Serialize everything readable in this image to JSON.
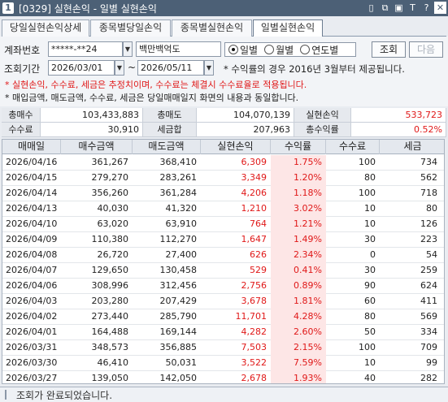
{
  "window": {
    "number": "1",
    "title": "[0329] 실현손익 - 일별 실현손익",
    "icons": [
      "restore-icon",
      "new-window-icon",
      "copy-icon",
      "pin-icon",
      "help-icon",
      "close-icon"
    ],
    "icon_glyphs": [
      "▯",
      "⧉",
      "▣",
      "T",
      "?",
      "✕"
    ]
  },
  "tabs": [
    {
      "label": "당일실현손익상세",
      "active": false
    },
    {
      "label": "종목별당일손익",
      "active": false
    },
    {
      "label": "종목별실현손익",
      "active": false
    },
    {
      "label": "일별실현손익",
      "active": true
    }
  ],
  "form": {
    "account_label": "계좌번호",
    "account_value": "*****-**24",
    "account_name": "백만백억도",
    "radio": [
      {
        "label": "일별",
        "checked": true
      },
      {
        "label": "월별",
        "checked": false
      },
      {
        "label": "연도별",
        "checked": false
      }
    ],
    "query_button": "조회",
    "next_button": "다음",
    "period_label": "조회기간",
    "start_date": "2026/03/01",
    "tilde": "~",
    "end_date": "2026/05/11",
    "period_note": "* 수익률의 경우 2016년 3월부터 제공됩니다.",
    "note1": "* 실현손익, 수수료, 세금은 추정치이며, 수수료는 체결시 수수료율로 적용됩니다.",
    "note2": "* 매입금액, 매도금액, 수수료, 세금은 당일매매일지 화면의 내용과 동일합니다."
  },
  "summary": {
    "total_buy_label": "총매수",
    "total_buy": "103,433,883",
    "total_sell_label": "총매도",
    "total_sell": "104,070,139",
    "realized_label": "실현손익",
    "realized": "533,723",
    "fee_label": "수수료",
    "fee": "30,910",
    "tax_label": "세금합",
    "tax": "207,963",
    "return_label": "총수익률",
    "return": "0.52%"
  },
  "table": {
    "columns": [
      "매매일",
      "매수금액",
      "매도금액",
      "실현손익",
      "수익률",
      "수수료",
      "세금"
    ],
    "rows": [
      [
        "2026/04/16",
        "361,267",
        "368,410",
        "6,309",
        "1.75%",
        "100",
        "734"
      ],
      [
        "2026/04/15",
        "279,270",
        "283,261",
        "3,349",
        "1.20%",
        "80",
        "562"
      ],
      [
        "2026/04/14",
        "356,260",
        "361,284",
        "4,206",
        "1.18%",
        "100",
        "718"
      ],
      [
        "2026/04/13",
        "40,030",
        "41,320",
        "1,210",
        "3.02%",
        "10",
        "80"
      ],
      [
        "2026/04/10",
        "63,020",
        "63,910",
        "764",
        "1.21%",
        "10",
        "126"
      ],
      [
        "2026/04/09",
        "110,380",
        "112,270",
        "1,647",
        "1.49%",
        "30",
        "223"
      ],
      [
        "2026/04/08",
        "26,720",
        "27,400",
        "626",
        "2.34%",
        "0",
        "54"
      ],
      [
        "2026/04/07",
        "129,650",
        "130,458",
        "529",
        "0.41%",
        "30",
        "259"
      ],
      [
        "2026/04/06",
        "308,996",
        "312,456",
        "2,756",
        "0.89%",
        "90",
        "624"
      ],
      [
        "2026/04/03",
        "203,280",
        "207,429",
        "3,678",
        "1.81%",
        "60",
        "411"
      ],
      [
        "2026/04/02",
        "273,440",
        "285,790",
        "11,701",
        "4.28%",
        "80",
        "569"
      ],
      [
        "2026/04/01",
        "164,488",
        "169,144",
        "4,282",
        "2.60%",
        "50",
        "334"
      ],
      [
        "2026/03/31",
        "348,573",
        "356,885",
        "7,503",
        "2.15%",
        "100",
        "709"
      ],
      [
        "2026/03/30",
        "46,410",
        "50,031",
        "3,522",
        "7.59%",
        "10",
        "99"
      ],
      [
        "2026/03/27",
        "139,050",
        "142,050",
        "2,678",
        "1.93%",
        "40",
        "282"
      ]
    ]
  },
  "status": {
    "text": "조회가 완료되었습니다."
  },
  "colors": {
    "titlebar": "#4c6076",
    "profit_red": "#e01818",
    "return_bg": "#fde6e6"
  }
}
